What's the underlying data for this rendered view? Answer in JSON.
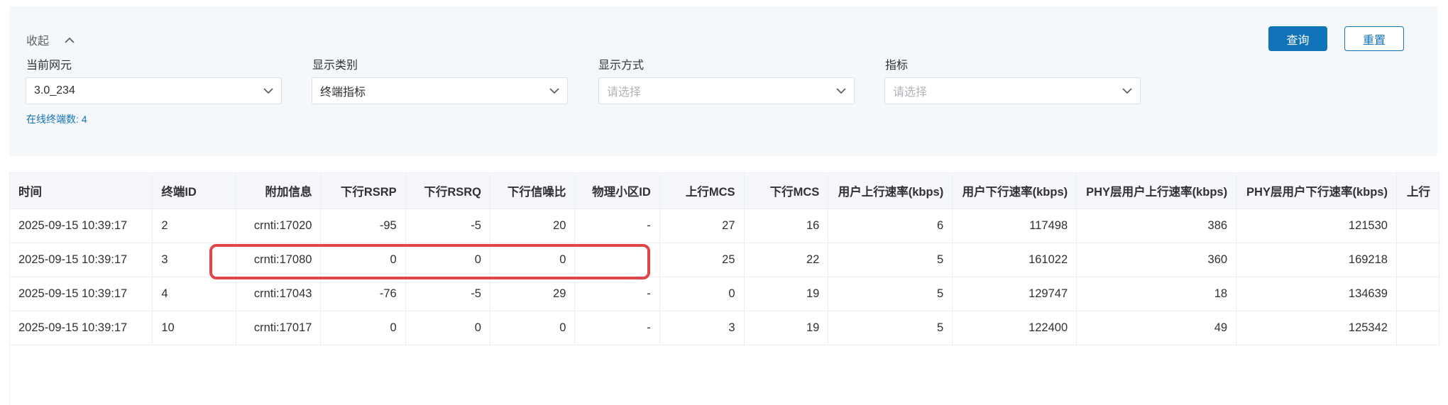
{
  "filters": {
    "collapse_label": "收起",
    "query_button": "查询",
    "reset_button": "重置",
    "network_element": {
      "label": "当前网元",
      "value": "3.0_234"
    },
    "display_category": {
      "label": "显示类别",
      "value": "终端指标"
    },
    "display_mode": {
      "label": "显示方式",
      "placeholder": "请选择"
    },
    "indicator": {
      "label": "指标",
      "placeholder": "请选择"
    },
    "online_terminals": "在线终端数: 4"
  },
  "table": {
    "headers": [
      "时间",
      "终端ID",
      "附加信息",
      "下行RSRP",
      "下行RSRQ",
      "下行信噪比",
      "物理小区ID",
      "上行MCS",
      "下行MCS",
      "用户上行速率(kbps)",
      "用户下行速率(kbps)",
      "PHY层用户上行速率(kbps)",
      "PHY层用户下行速率(kbps)",
      "上行"
    ],
    "rows": [
      [
        "2025-09-15 10:39:17",
        "2",
        "crnti:17020",
        "-95",
        "-5",
        "20",
        "-",
        "27",
        "16",
        "6",
        "117498",
        "386",
        "121530",
        ""
      ],
      [
        "2025-09-15 10:39:17",
        "3",
        "crnti:17080",
        "0",
        "0",
        "0",
        "-",
        "25",
        "22",
        "5",
        "161022",
        "360",
        "169218",
        ""
      ],
      [
        "2025-09-15 10:39:17",
        "4",
        "crnti:17043",
        "-76",
        "-5",
        "29",
        "-",
        "0",
        "19",
        "5",
        "129747",
        "18",
        "134639",
        ""
      ],
      [
        "2025-09-15 10:39:17",
        "10",
        "crnti:17017",
        "0",
        "0",
        "0",
        "-",
        "3",
        "19",
        "5",
        "122400",
        "49",
        "125342",
        ""
      ]
    ]
  },
  "colors": {
    "primary": "#1173b7",
    "highlight": "#e0454a",
    "panel_bg": "#f5f8fb",
    "header_bg": "#f5f7fa"
  }
}
